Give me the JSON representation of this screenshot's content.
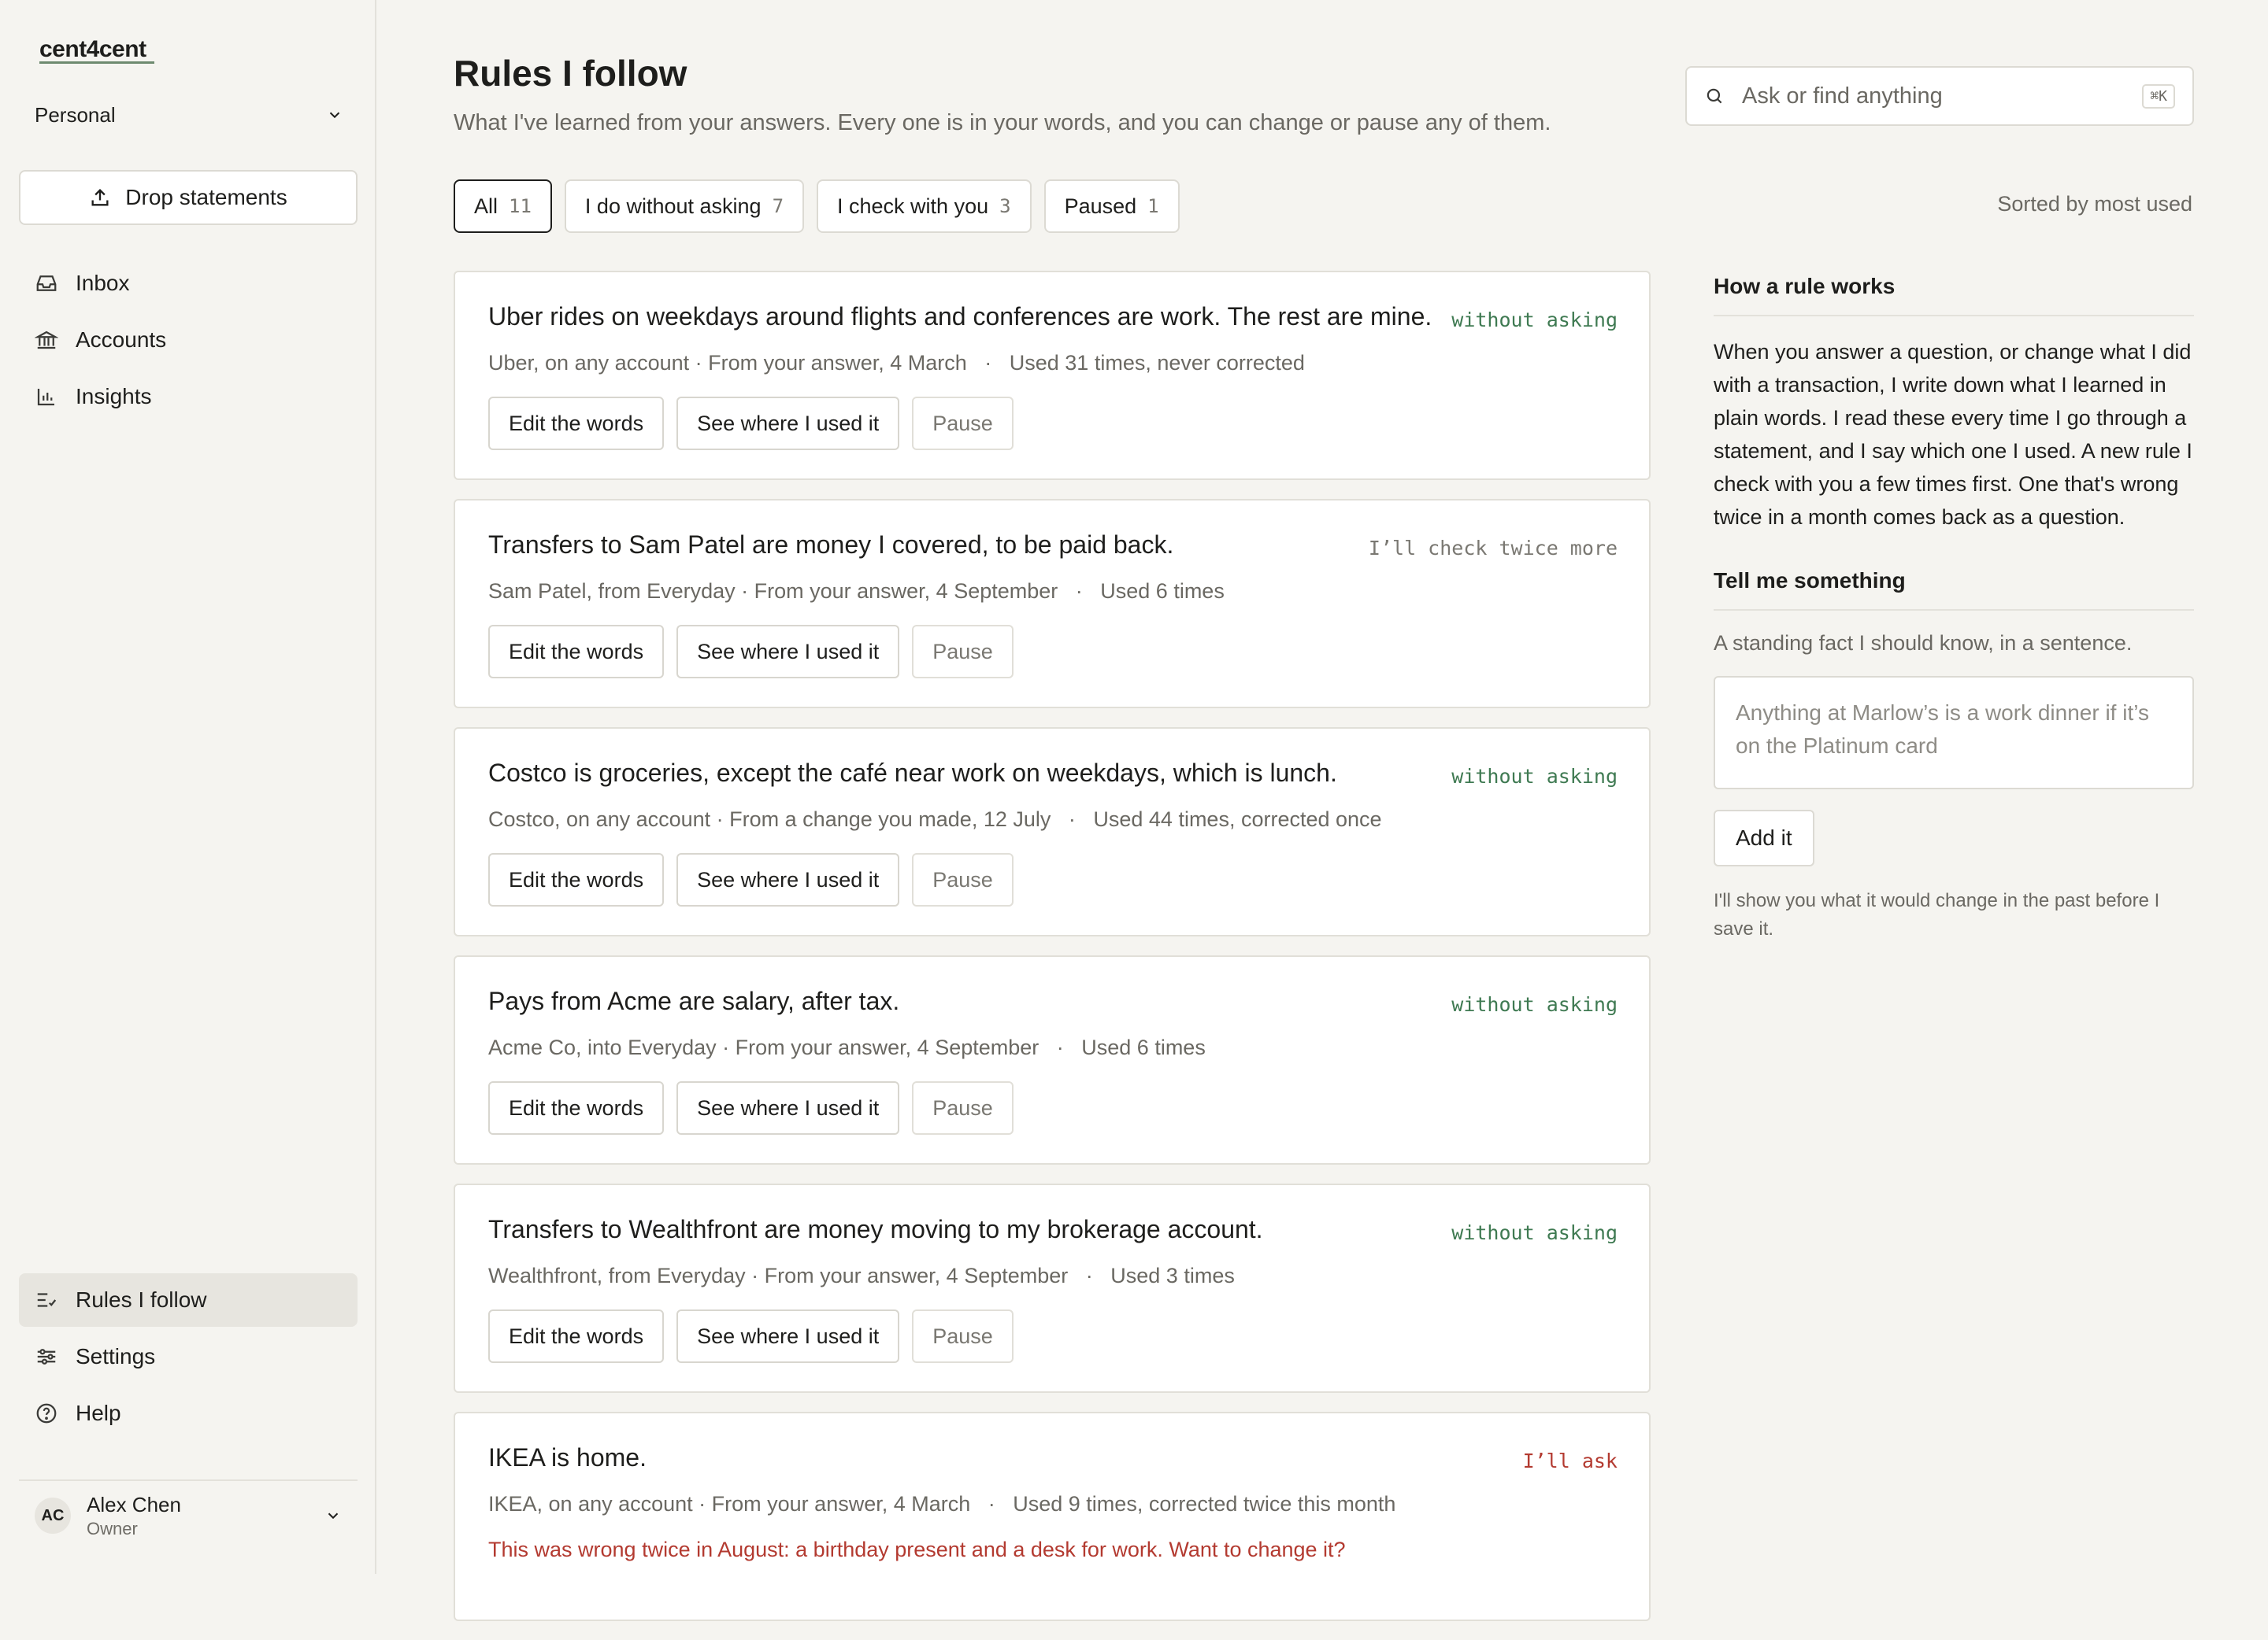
{
  "app": {
    "logo": "cent4cent",
    "workspace": "Personal",
    "drop_label": "Drop statements"
  },
  "nav": {
    "top": [
      {
        "label": "Inbox",
        "icon": "inbox-icon"
      },
      {
        "label": "Accounts",
        "icon": "bank-icon"
      },
      {
        "label": "Insights",
        "icon": "bar-chart-icon"
      }
    ],
    "bottom": [
      {
        "label": "Rules I follow",
        "icon": "rules-icon",
        "active": true
      },
      {
        "label": "Settings",
        "icon": "sliders-icon"
      },
      {
        "label": "Help",
        "icon": "help-icon"
      }
    ]
  },
  "user": {
    "initials": "AC",
    "name": "Alex Chen",
    "role": "Owner"
  },
  "page": {
    "title": "Rules I follow",
    "subtitle": "What I've learned from your answers. Every one is in your words, and you can change or pause any of them."
  },
  "search": {
    "placeholder": "Ask or find anything",
    "shortcut": "⌘K"
  },
  "filters": [
    {
      "label": "All",
      "count": "11",
      "active": true
    },
    {
      "label": "I do without asking",
      "count": "7"
    },
    {
      "label": "I check with you",
      "count": "3"
    },
    {
      "label": "Paused",
      "count": "1"
    }
  ],
  "sort_label": "Sorted by most used",
  "actions": {
    "edit": "Edit the words",
    "see": "See where I used it",
    "pause": "Pause"
  },
  "rules": [
    {
      "title": "Uber rides on weekdays around flights and conferences are work. The rest are mine.",
      "status": "without asking",
      "meta": "Uber, on any account · From your answer, 4 March   ·   Used 31 times, never corrected"
    },
    {
      "title": "Transfers to Sam Patel are money I covered, to be paid back.",
      "status": "I’ll check twice more",
      "meta": "Sam Patel, from Everyday · From your answer, 4 September   ·   Used 6 times"
    },
    {
      "title": "Costco is groceries, except the café near work on weekdays, which is lunch.",
      "status": "without asking",
      "meta": "Costco, on any account · From a change you made, 12 July   ·   Used 44 times, corrected once"
    },
    {
      "title": "Pays from Acme are salary, after tax.",
      "status": "without asking",
      "meta": "Acme Co, into Everyday · From your answer, 4 September   ·   Used 6 times"
    },
    {
      "title": "Transfers to Wealthfront are money moving to my brokerage account.",
      "status": "without asking",
      "meta": "Wealthfront, from Everyday · From your answer, 4 September   ·   Used 3 times"
    },
    {
      "title": "IKEA is home.",
      "status": "I’ll ask",
      "meta": "IKEA, on any account · From your answer, 4 March   ·   Used 9 times, corrected twice this month",
      "warning": "This was wrong twice in August: a birthday present and a desk for work. Want to change it?"
    }
  ],
  "panel": {
    "how_title": "How a rule works",
    "how_body": "When you answer a question, or change what I did with a transaction, I write down what I learned in plain words. I read these every time I go through a statement, and I say which one I used. A new rule I check with you a few times first. One that's wrong twice in a month comes back as a question.",
    "tell_title": "Tell me something",
    "tell_hint": "A standing fact I should know, in a sentence.",
    "tell_placeholder": "Anything at Marlow’s is a work dinner if it’s on the Platinum card",
    "add_label": "Add it",
    "note": "I'll show you what it would change in the past before I save it."
  },
  "colors": {
    "accent_auto": "#3f7a52",
    "warning": "#b33a30",
    "background": "#f5f4f0"
  }
}
